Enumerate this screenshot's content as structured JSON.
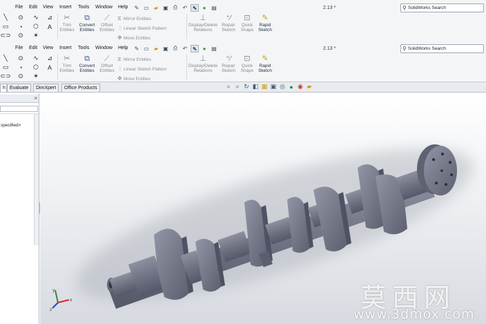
{
  "menu": [
    "File",
    "Edit",
    "View",
    "Insert",
    "Tools",
    "Window",
    "Help"
  ],
  "document_title": "2.13 *",
  "search": {
    "label": "SolidWorks Search"
  },
  "command_manager": {
    "trim": "Trim\nEntities",
    "convert": "Convert\nEntities",
    "offset": "Offset\nEntities",
    "mirror": "Mirror Entities",
    "linear_pattern": "Linear Sketch Pattern",
    "move": "Move Entities",
    "display_delete": "Display/Delete\nRelations",
    "repair": "Repair\nSketch",
    "quick_snaps": "Quick\nSnaps",
    "rapid_sketch": "Rapid\nSketch"
  },
  "tabs": [
    {
      "label": "h",
      "active": true
    },
    {
      "label": "Evaluate",
      "active": false
    },
    {
      "label": "DimXpert",
      "active": false
    },
    {
      "label": "Office Products",
      "active": false
    }
  ],
  "feature_tree": {
    "status_text": "specified>"
  },
  "watermark": {
    "chinese": "莫西网",
    "url": "www.3dmox.com"
  },
  "model": {
    "name": "crankshaft",
    "color": "#6f7282"
  },
  "colors": {
    "accent": "#c9a11a",
    "toolbar_bg": "#f4f5f7",
    "viewport_top": "#ffffff",
    "viewport_bottom": "#d7dbe1"
  }
}
